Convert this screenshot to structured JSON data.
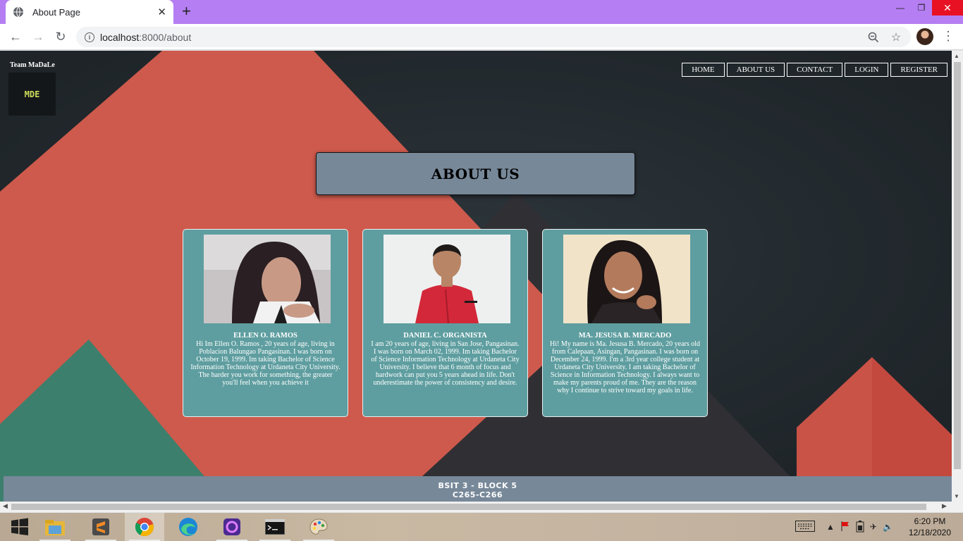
{
  "browser": {
    "tab_title": "About Page",
    "new_tab": "+",
    "url_host": "localhost",
    "url_path": ":8000/about"
  },
  "page": {
    "brand": "Team MaDaLe",
    "logo_text": "MDE",
    "nav": [
      "HOME",
      "ABOUT US",
      "CONTACT",
      "LOGIN",
      "REGISTER"
    ],
    "heading": "ABOUT US",
    "members": [
      {
        "name": "ELLEN O. RAMOS",
        "bio": "Hi Im Ellen O. Ramos , 20 years of age, living in Poblacion Balungao Pangasinan. I was born on October 19, 1999. Im taking Bachelor of Science Information Technology at Urdaneta City University. The harder you work for something, the greater you'll feel when you achieve it"
      },
      {
        "name": "DANIEL C. ORGANISTA",
        "bio": "I am 20 years of age, living in San Jose, Pangasinan. I was born on March 02, 1999. Im taking Bachelor of Science Information Technology at Urdaneta City University. I believe that 6 month of focus and hardwork can put you 5 years ahead in life. Don't underestimate the power of consistency and desire."
      },
      {
        "name": "MA. JESUSA B. MERCADO",
        "bio": "Hi! My name is Ma. Jesusa B. Mercado, 20 years old from Calepaan, Asingan, Pangasinan. I was born on December 24, 1999. I'm a 3rd year college student at Urdaneta City University. I am taking Bachelor of Science in Information Technology. I always want to make my parents proud of me. They are the reason why I continue to strive toward my goals in life."
      }
    ],
    "footer_line1": "BSIT 3 - BLOCK 5",
    "footer_line2": "C265-C266"
  },
  "taskbar": {
    "time": "6:20 PM",
    "date": "12/18/2020",
    "apps": [
      "file-explorer",
      "sublime-text",
      "chrome",
      "edge",
      "phone-link",
      "command-prompt",
      "paint"
    ]
  },
  "colors": {
    "tabbar": "#b57ef2",
    "page_bg": "#232a2f",
    "card": "#5f9ea0",
    "heading_box": "#778899",
    "mountain_red": "#cd5a4c",
    "mountain_green": "#3d7f6d"
  }
}
